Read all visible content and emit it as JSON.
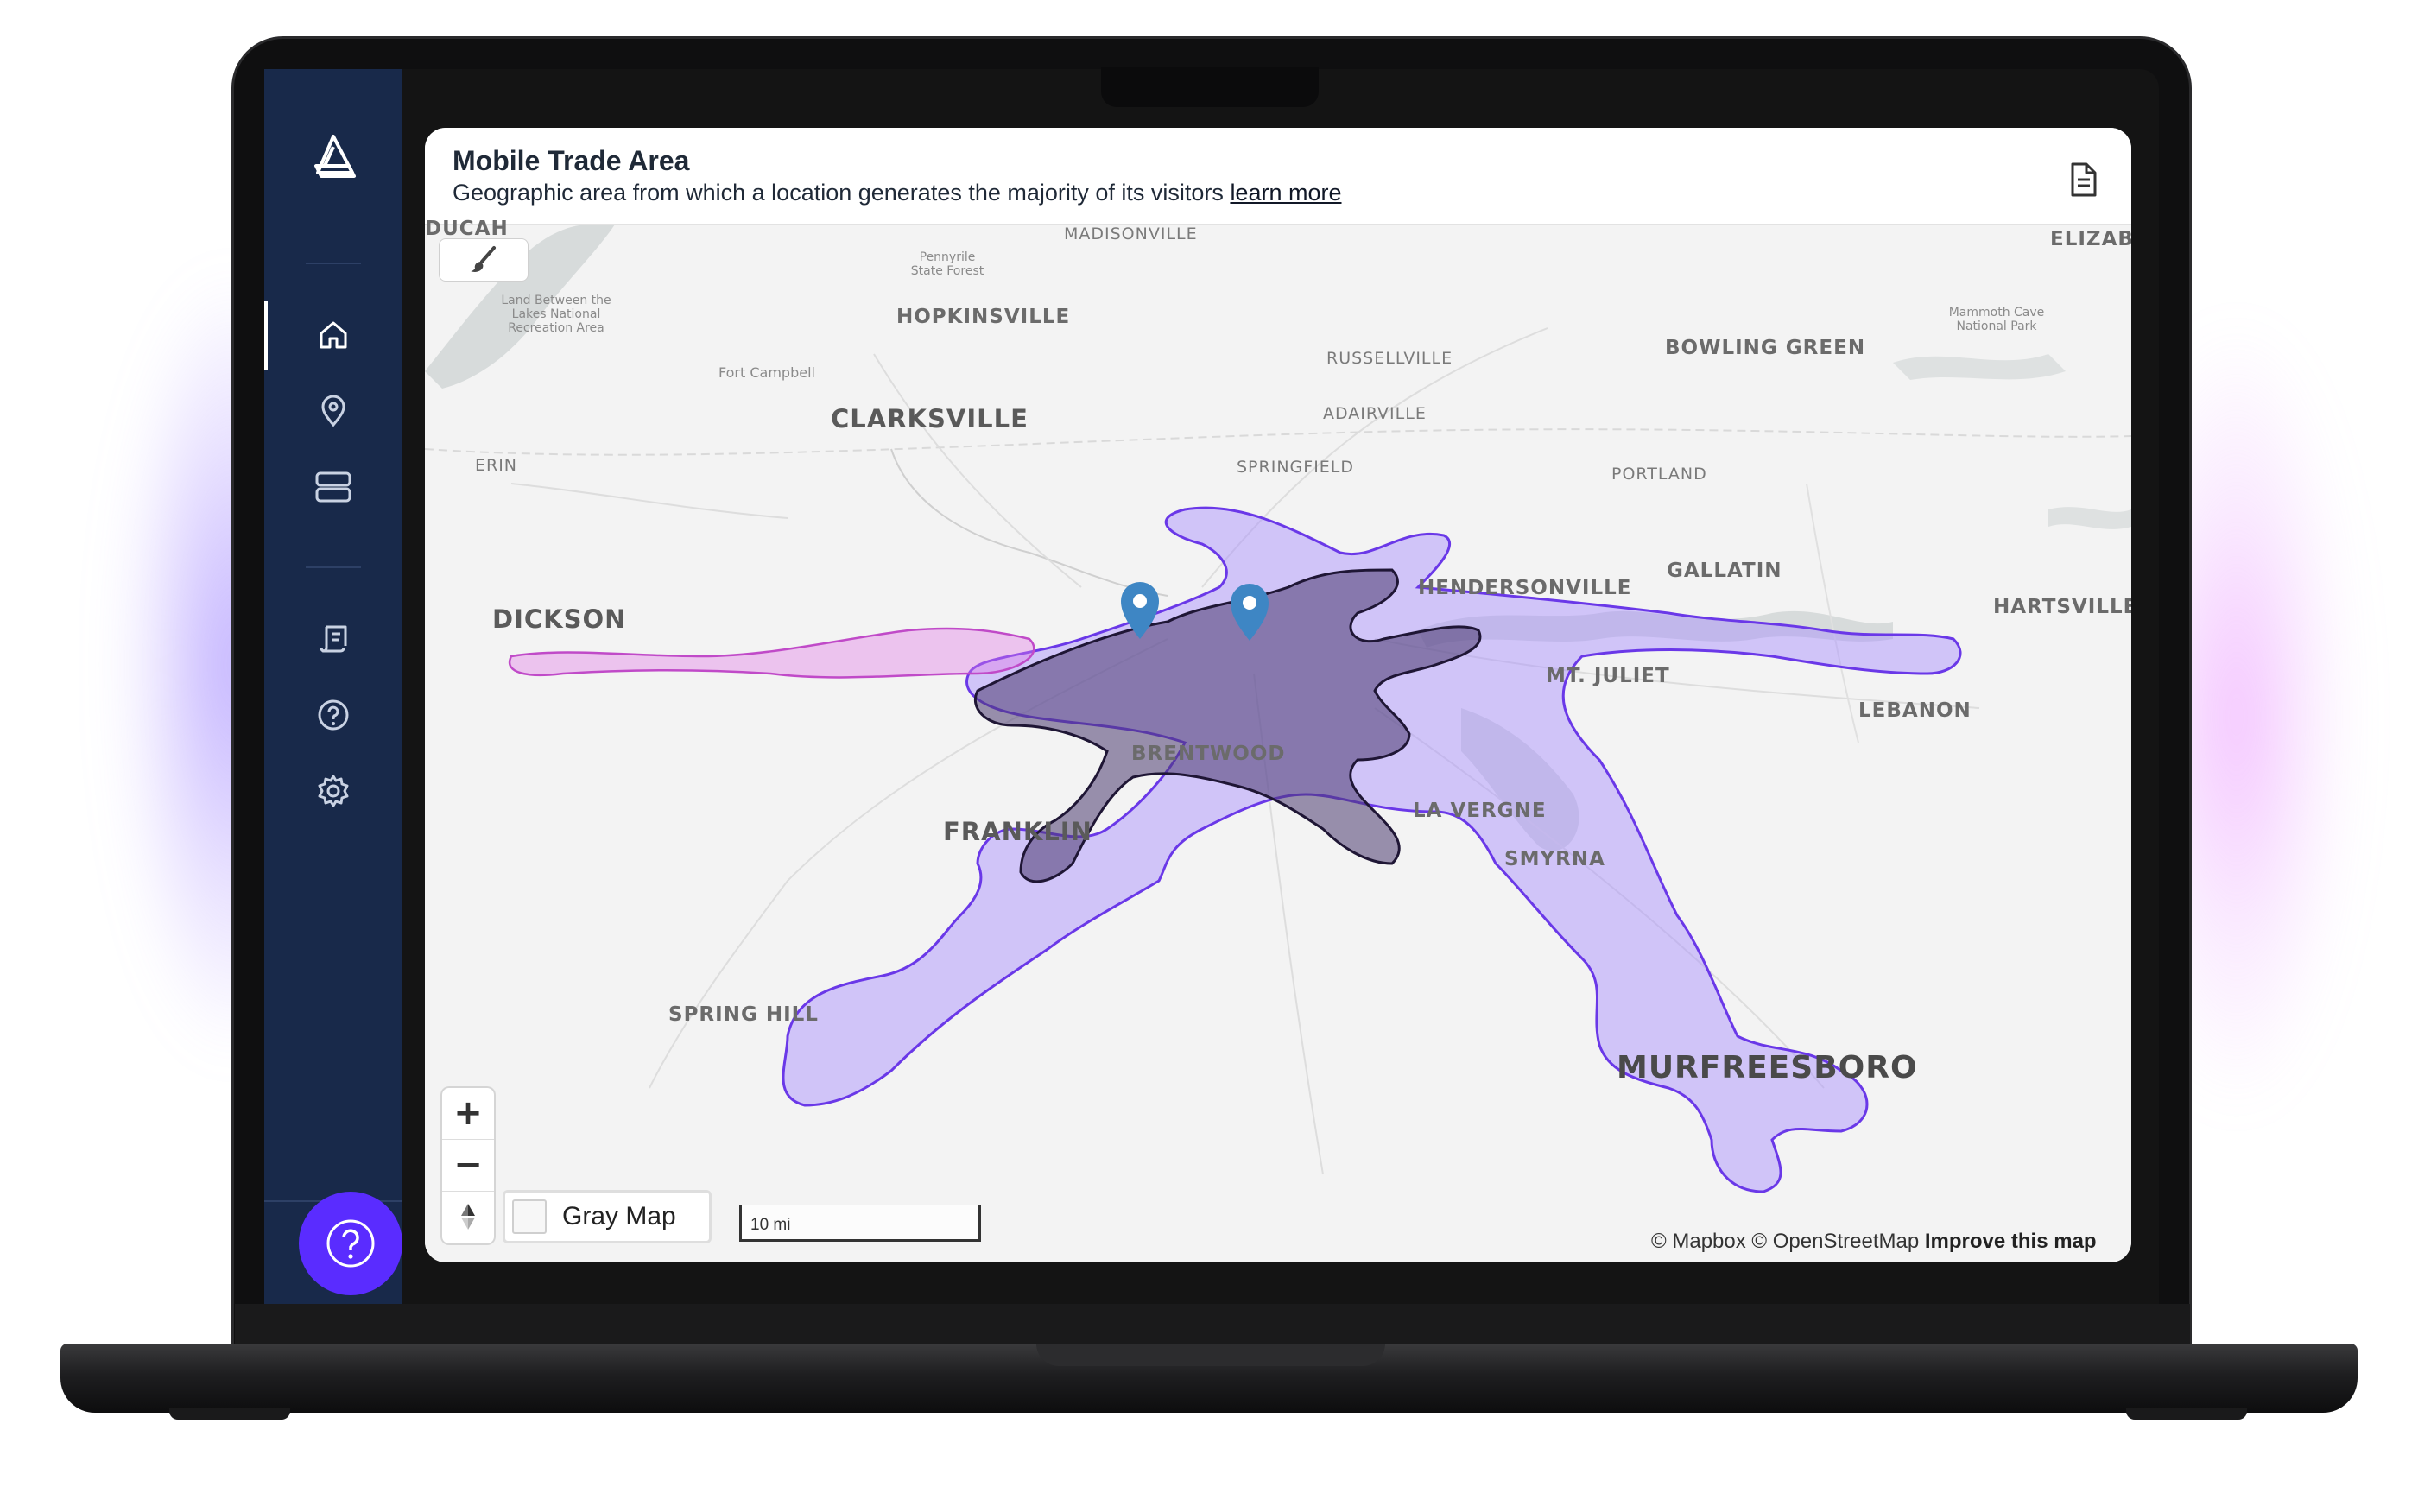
{
  "card": {
    "title": "Mobile Trade Area",
    "subtitle": "Geographic area from which a location generates the majority of its visitors",
    "learn_more": "learn more"
  },
  "sidebar": {
    "items": [
      {
        "icon": "home-icon",
        "active": true
      },
      {
        "icon": "map-pin-icon",
        "active": false
      },
      {
        "icon": "database-icon",
        "active": false
      },
      {
        "icon": "report-icon",
        "active": false
      },
      {
        "icon": "help-circle-icon",
        "active": false
      },
      {
        "icon": "gear-icon",
        "active": false
      }
    ],
    "help_button": "?"
  },
  "map": {
    "labels": {
      "paducah": "DUCAH",
      "madisonville": "MADISONVILLE",
      "elizabethtown": "ELIZABET",
      "pennyrile": "Pennyrile State Forest",
      "land_between_lakes": "Land Between the Lakes National Recreation Area",
      "hopkinsville": "HOPKINSVILLE",
      "mammoth_cave": "Mammoth Cave National Park",
      "bowling_green": "BOWLING GREEN",
      "russellville": "RUSSELLVILLE",
      "fort_campbell": "Fort Campbell",
      "clarksville": "CLARKSVILLE",
      "adairville": "ADAIRVILLE",
      "erin": "ERIN",
      "springfield": "SPRINGFIELD",
      "portland": "PORTLAND",
      "gallatin": "GALLATIN",
      "hendersonville": "HENDERSONVILLE",
      "hartsville": "HARTSVILLE",
      "dickson": "DICKSON",
      "mt_juliet": "MT. JULIET",
      "lebanon": "LEBANON",
      "brentwood": "BRENTWOOD",
      "la_vergne": "LA VERGNE",
      "franklin": "FRANKLIN",
      "smyrna": "SMYRNA",
      "spring_hill": "SPRING HILL",
      "murfreesboro": "MURFREESBORO"
    },
    "zoom_in": "+",
    "zoom_out": "−",
    "compass": "▲",
    "gray_map_label": "Gray Map",
    "gray_map_checked": false,
    "scale_label": "10 mi",
    "attribution_mapbox": "© Mapbox",
    "attribution_osm": "© OpenStreetMap",
    "attribution_improve": "Improve this map",
    "colors": {
      "land": "#f3f3f3",
      "water": "#d4d8d8",
      "trade_area_1": "#a68bff",
      "trade_area_2": "#e07be6",
      "trade_area_3": "#4a3a70",
      "marker": "#3e86c4",
      "sidebar": "#18294a",
      "accent": "#5a2cff"
    }
  }
}
